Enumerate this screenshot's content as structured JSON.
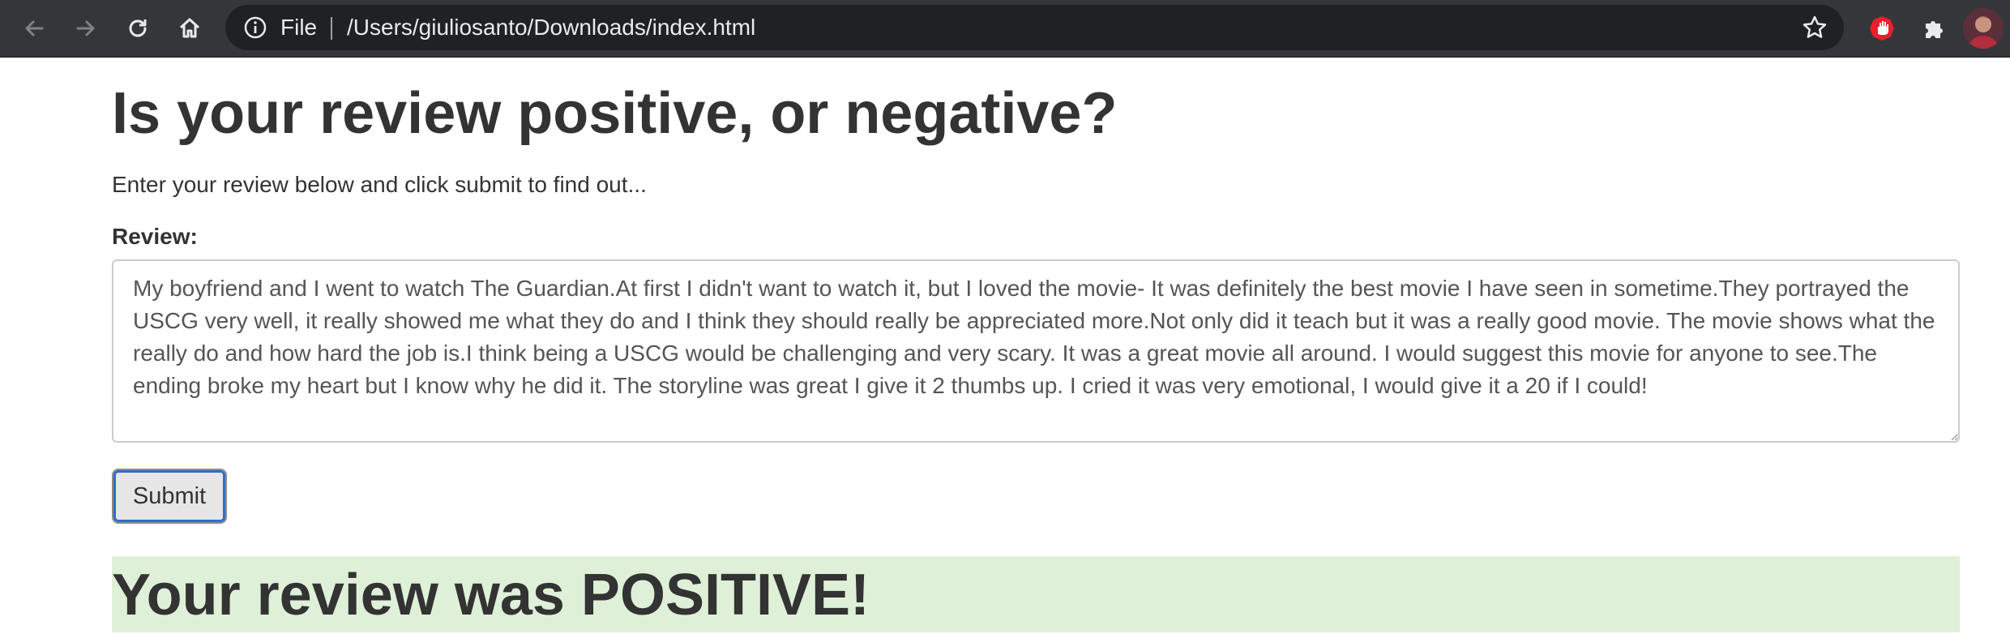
{
  "browser": {
    "address_scheme": "File",
    "address_url": "/Users/giuliosanto/Downloads/index.html",
    "icons": [
      "back-icon",
      "forward-icon",
      "reload-icon",
      "home-icon",
      "info-icon",
      "star-icon",
      "stop-hand-icon",
      "puzzle-icon",
      "avatar"
    ],
    "colors": {
      "toolbar": "#35363a",
      "omnibox": "#202124",
      "extension_red": "#e8202c"
    }
  },
  "page": {
    "heading": "Is your review positive, or negative?",
    "lead": "Enter your review below and click submit to find out...",
    "review_label": "Review:",
    "review_text": "My boyfriend and I went to watch The Guardian.At first I didn't want to watch it, but I loved the movie- It was definitely the best movie I have seen in sometime.They portrayed the USCG very well, it really showed me what they do and I think they should really be appreciated more.Not only did it teach but it was a really good movie. The movie shows what the really do and how hard the job is.I think being a USCG would be challenging and very scary. It was a great movie all around. I would suggest this movie for anyone to see.The ending broke my heart but I know why he did it. The storyline was great I give it 2 thumbs up. I cried it was very emotional, I would give it a 20 if I could!",
    "submit_label": "Submit",
    "result_text": "Your review was POSITIVE!",
    "colors": {
      "result_background": "#dff0d8",
      "submit_focus": "#2f6fc7"
    }
  }
}
